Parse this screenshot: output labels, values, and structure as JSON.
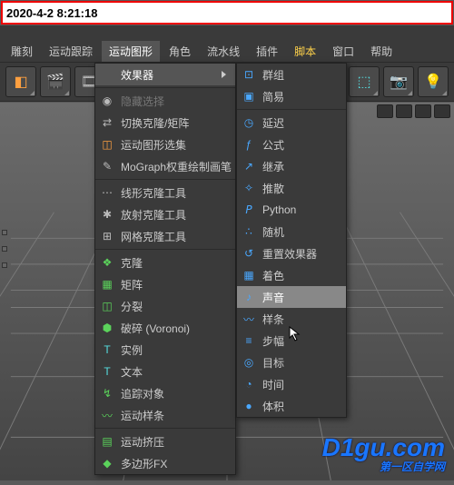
{
  "timestamp": "2020-4-2 8:21:18",
  "menubar": {
    "items": [
      {
        "label": "雕刻"
      },
      {
        "label": "运动跟踪"
      },
      {
        "label": "运动图形"
      },
      {
        "label": "角色"
      },
      {
        "label": "流水线"
      },
      {
        "label": "插件"
      },
      {
        "label": "脚本"
      },
      {
        "label": "窗口"
      },
      {
        "label": "帮助"
      }
    ]
  },
  "menu1": {
    "header": "效果器",
    "items": [
      {
        "label": "隐藏选择",
        "dim": true,
        "ico": "eye",
        "color": "c-gray"
      },
      {
        "label": "切换克隆/矩阵",
        "ico": "swap",
        "color": "c-gray"
      },
      {
        "label": "运动图形选集",
        "ico": "sel",
        "color": "c-orange"
      },
      {
        "label": "MoGraph权重绘制画笔",
        "ico": "brush",
        "color": "c-gray"
      },
      {
        "sep": true
      },
      {
        "label": "线形克隆工具",
        "ico": "line",
        "color": "c-gray"
      },
      {
        "label": "放射克隆工具",
        "ico": "radial",
        "color": "c-gray"
      },
      {
        "label": "网格克隆工具",
        "ico": "gridc",
        "color": "c-gray"
      },
      {
        "sep": true
      },
      {
        "label": "克隆",
        "ico": "clone",
        "color": "c-green"
      },
      {
        "label": "矩阵",
        "ico": "matrix",
        "color": "c-green"
      },
      {
        "label": "分裂",
        "ico": "frac",
        "color": "c-green"
      },
      {
        "label": "破碎 (Voronoi)",
        "ico": "voro",
        "color": "c-green"
      },
      {
        "label": "实例",
        "ico": "inst",
        "color": "c-cyan"
      },
      {
        "label": "文本",
        "ico": "text",
        "color": "c-cyan"
      },
      {
        "label": "追踪对象",
        "ico": "trace",
        "color": "c-green"
      },
      {
        "label": "运动样条",
        "ico": "mspline",
        "color": "c-green"
      },
      {
        "sep": true
      },
      {
        "label": "运动挤压",
        "ico": "mext",
        "color": "c-green"
      },
      {
        "label": "多边形FX",
        "ico": "pfx",
        "color": "c-green"
      }
    ]
  },
  "menu2": {
    "items": [
      {
        "label": "群组",
        "ico": "grp",
        "color": "c-blue"
      },
      {
        "label": "简易",
        "ico": "plain",
        "color": "c-blue"
      },
      {
        "sep": true
      },
      {
        "label": "延迟",
        "ico": "delay",
        "color": "c-blue"
      },
      {
        "label": "公式",
        "ico": "form",
        "color": "c-blue"
      },
      {
        "label": "继承",
        "ico": "inh",
        "color": "c-blue"
      },
      {
        "label": "推散",
        "ico": "push",
        "color": "c-blue"
      },
      {
        "label": "Python",
        "ico": "py",
        "color": "c-blue"
      },
      {
        "label": "随机",
        "ico": "rand",
        "color": "c-blue"
      },
      {
        "label": "重置效果器",
        "ico": "reset",
        "color": "c-blue"
      },
      {
        "label": "着色",
        "ico": "shade",
        "color": "c-blue"
      },
      {
        "label": "声音",
        "ico": "sound",
        "color": "c-blue",
        "hi": true
      },
      {
        "label": "样条",
        "ico": "spl",
        "color": "c-blue"
      },
      {
        "label": "步幅",
        "ico": "step",
        "color": "c-blue"
      },
      {
        "label": "目标",
        "ico": "targ",
        "color": "c-blue"
      },
      {
        "label": "时间",
        "ico": "time",
        "color": "c-blue"
      },
      {
        "label": "体积",
        "ico": "vol",
        "color": "c-blue"
      }
    ]
  },
  "watermark": {
    "main": "D1gu.com",
    "sub": "第一区自学网"
  }
}
